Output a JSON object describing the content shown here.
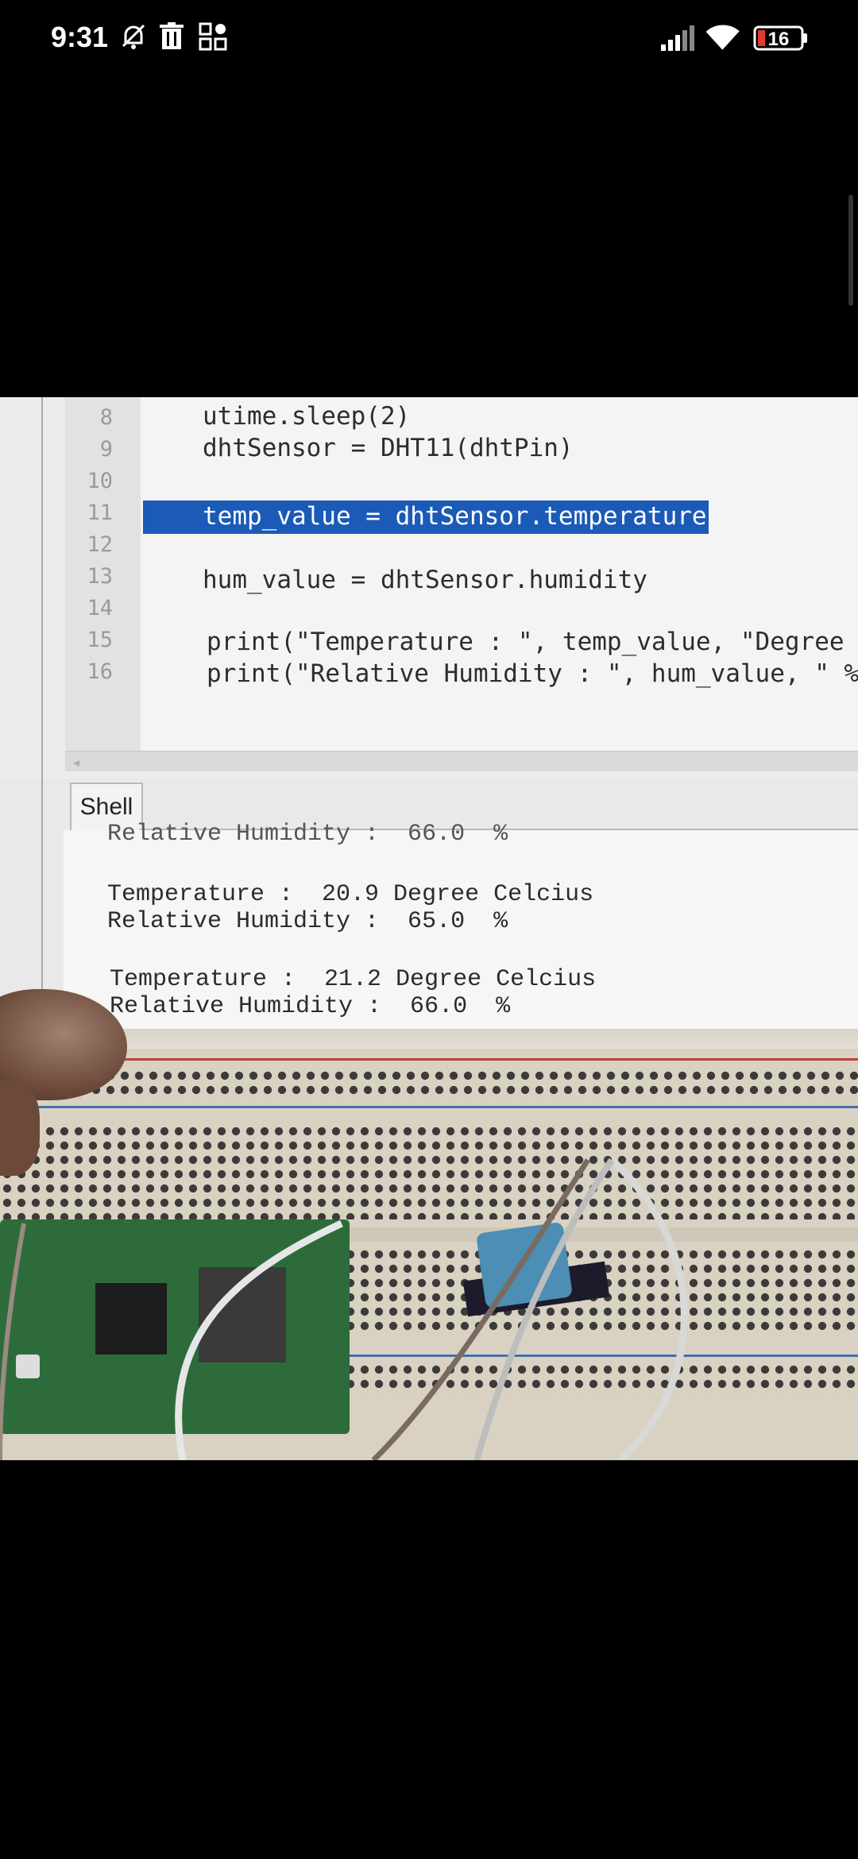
{
  "status_bar": {
    "time": "9:31",
    "battery": "16",
    "icons": [
      "mute-icon",
      "trash-icon",
      "apps-grid-icon",
      "signal-icon",
      "wifi-icon",
      "battery-icon"
    ]
  },
  "editor": {
    "lines": [
      {
        "number": "8",
        "code": "utime.sleep(2)"
      },
      {
        "number": "9",
        "code": "dhtSensor = DHT11(dhtPin)"
      },
      {
        "number": "10",
        "code": ""
      },
      {
        "number": "11",
        "code": "temp_value = dhtSensor.temperature",
        "selected": true
      },
      {
        "number": "12",
        "code": ""
      },
      {
        "number": "13",
        "code": "hum_value = dhtSensor.humidity"
      },
      {
        "number": "14",
        "code": ""
      },
      {
        "number": "15",
        "code": "print(\"Temperature : \", temp_value, \"Degree C"
      },
      {
        "number": "16",
        "code": "print(\"Relative Humidity : \", hum_value, \" %\""
      }
    ]
  },
  "shell": {
    "tab_label": "Shell",
    "output": [
      "Relative Humidity :  66.0  %",
      "",
      "Temperature :  20.9 Degree Celcius",
      "Relative Humidity :  65.0  %",
      "",
      "Temperature :  21.2 Degree Celcius",
      "Relative Humidity :  66.0  %"
    ]
  },
  "colors": {
    "selection": "#1b5bb7",
    "background": "#000000",
    "battery_accent": "#e53935"
  }
}
